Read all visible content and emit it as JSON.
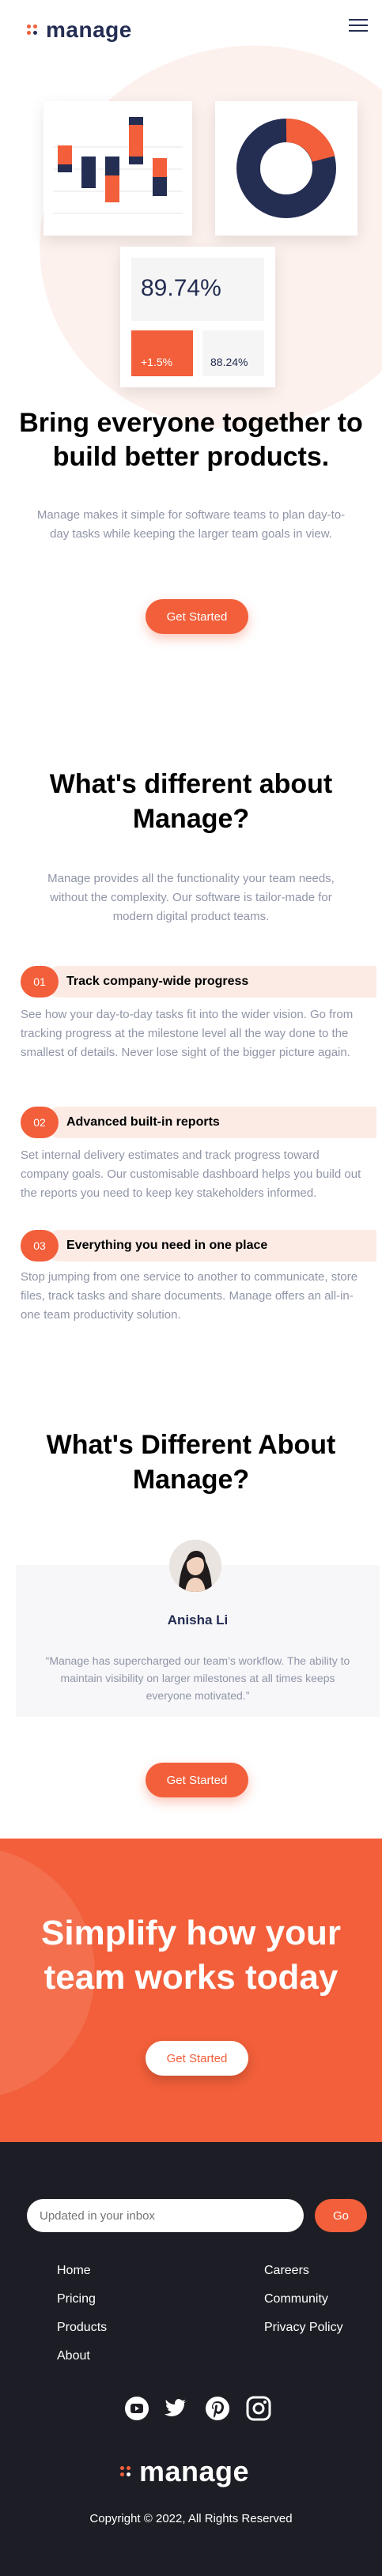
{
  "header": {
    "logo_text": "manage",
    "menu_icon": "hamburger-menu-icon"
  },
  "hero": {
    "stat_value": "89.74%",
    "stat_change": "+1.5%",
    "stat_secondary": "88.24%",
    "title": "Bring everyone together to build better products.",
    "subtitle": "Manage makes it simple for software teams to plan day-to-day tasks while keeping the larger team goals in view.",
    "cta_label": "Get Started"
  },
  "differences": {
    "title": "What's different about Manage?",
    "subtitle": "Manage provides all the functionality your team needs, without the complexity. Our software is tailor-made for modern digital product teams.",
    "features": [
      {
        "number": "01",
        "title": "Track company-wide progress",
        "body": "See how your day-to-day tasks fit into the wider vision. Go from tracking progress at the milestone level all the way done to the smallest of details. Never lose sight of the bigger picture again."
      },
      {
        "number": "02",
        "title": "Advanced built-in reports",
        "body": "Set internal delivery estimates and track progress toward company goals. Our customisable dashboard helps you build out the reports you need to keep key stakeholders informed."
      },
      {
        "number": "03",
        "title": "Everything you need in one place",
        "body": "Stop jumping from one service to another to communicate, store files, track tasks and share documents. Manage offers an all-in-one team productivity solution."
      }
    ]
  },
  "testimonials": {
    "title": "What's Different About Manage?",
    "items": [
      {
        "name": "Anisha Li",
        "quote": "“Manage has supercharged our team’s workflow. The ability to maintain visibility on larger milestones at all times keeps everyone motivated.”"
      }
    ],
    "cta_label": "Get Started"
  },
  "cta": {
    "title": "Simplify how your team works today",
    "button_label": "Get Started"
  },
  "footer": {
    "newsletter_placeholder": "Updated in your inbox",
    "newsletter_button": "Go",
    "links_left": [
      "Home",
      "Pricing",
      "Products",
      "About"
    ],
    "links_right": [
      "Careers",
      "Community",
      "Privacy Policy"
    ],
    "social_icons": [
      "youtube-icon",
      "twitter-icon",
      "pinterest-icon",
      "instagram-icon"
    ],
    "logo_text": "manage",
    "copyright": "Copyright © 2022, All Rights Reserved"
  },
  "colors": {
    "accent": "#f25f3a",
    "navy": "#242d52",
    "footer_bg": "#1d1e25",
    "pale_accent": "#fcebe5"
  }
}
